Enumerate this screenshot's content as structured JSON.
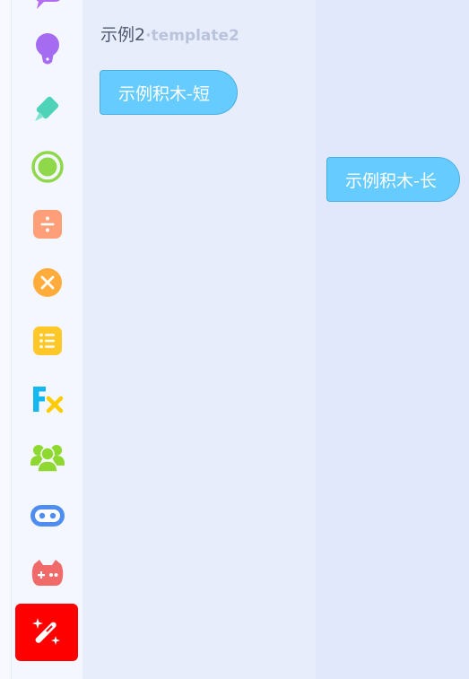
{
  "palette": {
    "title": "示例2",
    "subtitle": "·template2",
    "categories": [
      {
        "icon": "chat-bubble-icon",
        "color": "#b46cf0"
      },
      {
        "icon": "lightbulb-icon",
        "color": "#a56cf2"
      },
      {
        "icon": "pencil-icon",
        "color": "#4ed3b8"
      },
      {
        "icon": "radio-target-icon",
        "color": "#8fd84a"
      },
      {
        "icon": "division-icon",
        "color": "#ff9f7a"
      },
      {
        "icon": "times-icon",
        "color": "#ffac3a"
      },
      {
        "icon": "list-icon",
        "color": "#ffc828"
      },
      {
        "icon": "function-fx-icon",
        "color": "#14b8f0"
      },
      {
        "icon": "users-icon",
        "color": "#8fd830"
      },
      {
        "icon": "robot-icon",
        "color": "#4f8ef0"
      },
      {
        "icon": "gamepad-icon",
        "color": "#f06a6a"
      },
      {
        "icon": "magic-wand-icon",
        "color": "#ff0000",
        "active": true
      }
    ]
  },
  "blocks": {
    "short_label": "示例积木-短",
    "long_label": "示例积木-长",
    "color": "#66ccff"
  }
}
